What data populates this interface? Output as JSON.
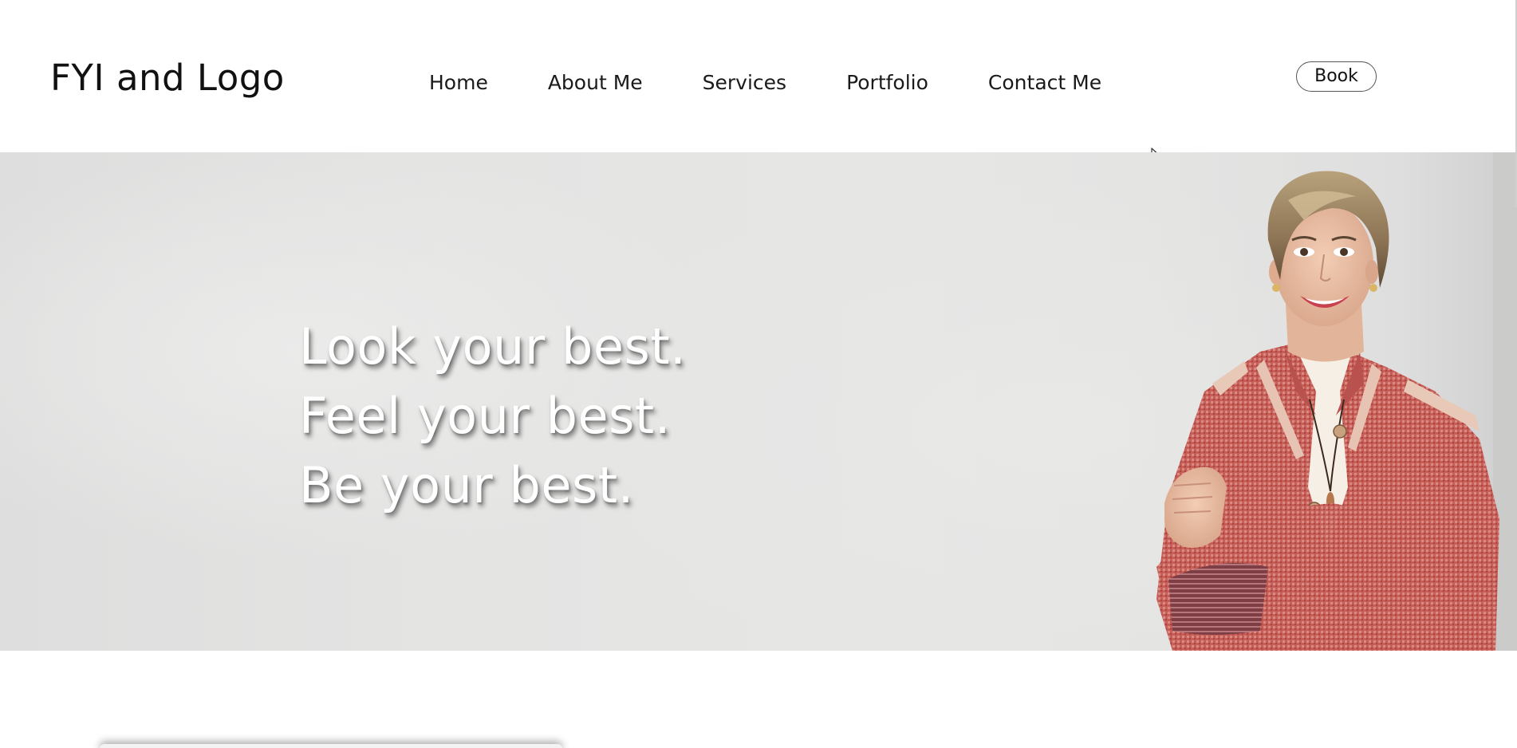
{
  "header": {
    "logo_text": "FYI and Logo",
    "nav": [
      {
        "label": "Home"
      },
      {
        "label": "About Me"
      },
      {
        "label": "Services"
      },
      {
        "label": "Portfolio"
      },
      {
        "label": "Contact Me"
      }
    ],
    "book_label": "Book"
  },
  "hero": {
    "lines": [
      "Look your best.",
      "Feel your best.",
      "Be your best."
    ]
  },
  "colors": {
    "hero_text": "#ffffff",
    "hero_background": "#e4e4e3",
    "jacket": "#c8615b"
  },
  "icons": {
    "cursor": "arrow-cursor-icon"
  }
}
